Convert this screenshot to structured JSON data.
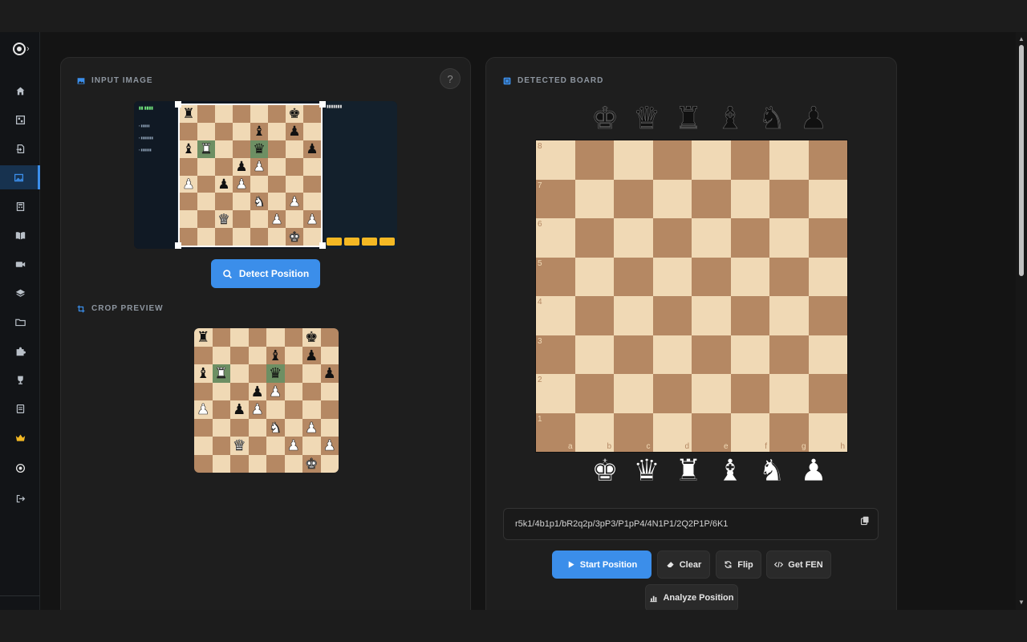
{
  "sidebar": {
    "items": [
      {
        "name": "home-icon"
      },
      {
        "name": "board-grid-icon"
      },
      {
        "name": "import-icon"
      },
      {
        "name": "image-icon",
        "active": true
      },
      {
        "name": "calculator-icon"
      },
      {
        "name": "book-icon"
      },
      {
        "name": "video-icon"
      },
      {
        "name": "layers-icon"
      },
      {
        "name": "folder-icon"
      },
      {
        "name": "puzzle-icon"
      },
      {
        "name": "trophy-icon"
      },
      {
        "name": "notebook-icon"
      },
      {
        "name": "crown-icon"
      },
      {
        "name": "target-icon"
      },
      {
        "name": "logout-icon"
      }
    ],
    "accent": "#3b8eea",
    "crown_color": "#f2b824"
  },
  "left_panel": {
    "input_title": "INPUT IMAGE",
    "help_label": "?",
    "detect_label": "Detect Position",
    "crop_title": "CROP PREVIEW"
  },
  "right_panel": {
    "title": "DETECTED BOARD",
    "ranks": [
      "8",
      "7",
      "6",
      "5",
      "4",
      "3",
      "2",
      "1"
    ],
    "files": [
      "a",
      "b",
      "c",
      "d",
      "e",
      "f",
      "g",
      "h"
    ],
    "black_tray": [
      "♚",
      "♛",
      "♜",
      "♝",
      "♞",
      "♟"
    ],
    "white_tray": [
      "♚",
      "♛",
      "♜",
      "♝",
      "♞",
      "♟"
    ],
    "fen": "r5k1/4b1p1/bR2q2p/3pP3/P1pP4/4N1P1/2Q2P1P/6K1",
    "buttons": {
      "start": "Start Position",
      "clear": "Clear",
      "flip": "Flip",
      "get_fen": "Get FEN",
      "analyze": "Analyze Position"
    }
  }
}
